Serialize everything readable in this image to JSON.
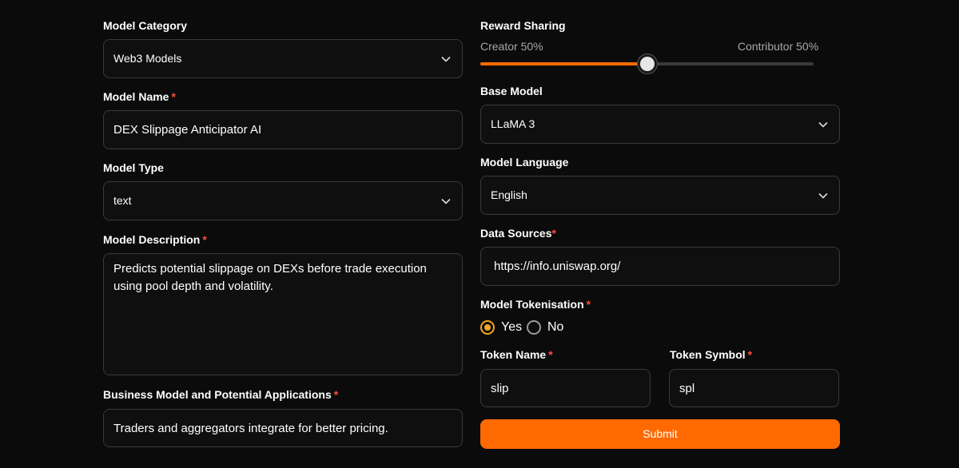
{
  "left": {
    "model_category": {
      "label": "Model Category",
      "value": "Web3 Models"
    },
    "model_name": {
      "label": "Model Name",
      "required_mark": "*",
      "value": "DEX Slippage Anticipator AI"
    },
    "model_type": {
      "label": "Model Type",
      "value": "text"
    },
    "model_description": {
      "label": "Model Description",
      "required_mark": "*",
      "value": "Predicts potential slippage on DEXs before trade execution using pool depth and volatility."
    },
    "business_model": {
      "label": "Business Model and Potential Applications",
      "required_mark": "*",
      "value": "Traders and aggregators integrate for better pricing."
    }
  },
  "right": {
    "reward_sharing": {
      "label": "Reward Sharing",
      "creator_label": "Creator 50%",
      "contributor_label": "Contributor 50%",
      "slider_fraction": 0.5
    },
    "base_model": {
      "label": "Base Model",
      "value": "LLaMA 3"
    },
    "model_language": {
      "label": "Model Language",
      "value": "English"
    },
    "data_sources": {
      "label": "Data Sources",
      "required_mark": "*",
      "value": "https://info.uniswap.org/"
    },
    "model_tokenisation": {
      "label": "Model Tokenisation",
      "required_mark": "*",
      "yes_label": "Yes",
      "no_label": "No",
      "selected": "Yes"
    },
    "token_name": {
      "label": "Token Name",
      "required_mark": "*",
      "value": "slip"
    },
    "token_symbol": {
      "label": "Token Symbol",
      "required_mark": "*",
      "value": "spl"
    },
    "submit_label": "Submit"
  },
  "colors": {
    "accent": "#ff6a00",
    "radio_selected": "#f5a623",
    "required": "#ff4d3d",
    "background": "#0b0b0b",
    "field_border": "#3a3a3a"
  },
  "icons": {
    "select_caret": "chevron-down-icon"
  }
}
